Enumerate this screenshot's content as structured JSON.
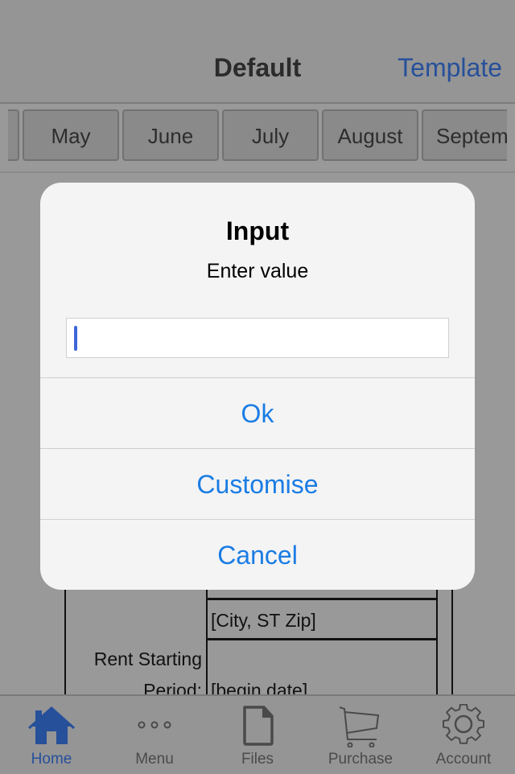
{
  "navbar": {
    "title": "Default",
    "right_button": "Template"
  },
  "months": [
    "",
    "May",
    "June",
    "July",
    "August",
    "Septem"
  ],
  "document": {
    "city_field": "[City, ST  Zip]",
    "rent_label_line1": "Rent Starting",
    "rent_label_line2": "Period:",
    "begin_date": "[begin date]"
  },
  "alert": {
    "title": "Input",
    "message": "Enter value",
    "input_value": "",
    "buttons": [
      "Ok",
      "Customise",
      "Cancel"
    ],
    "accent_color": "#1a7ce4"
  },
  "tabbar": {
    "active_color": "#27509a",
    "items": [
      {
        "label": "Home",
        "icon": "home-icon",
        "active": true
      },
      {
        "label": "Menu",
        "icon": "more-dots-icon",
        "active": false
      },
      {
        "label": "Files",
        "icon": "file-icon",
        "active": false
      },
      {
        "label": "Purchase",
        "icon": "cart-icon",
        "active": false
      },
      {
        "label": "Account",
        "icon": "gear-icon",
        "active": false
      }
    ]
  }
}
